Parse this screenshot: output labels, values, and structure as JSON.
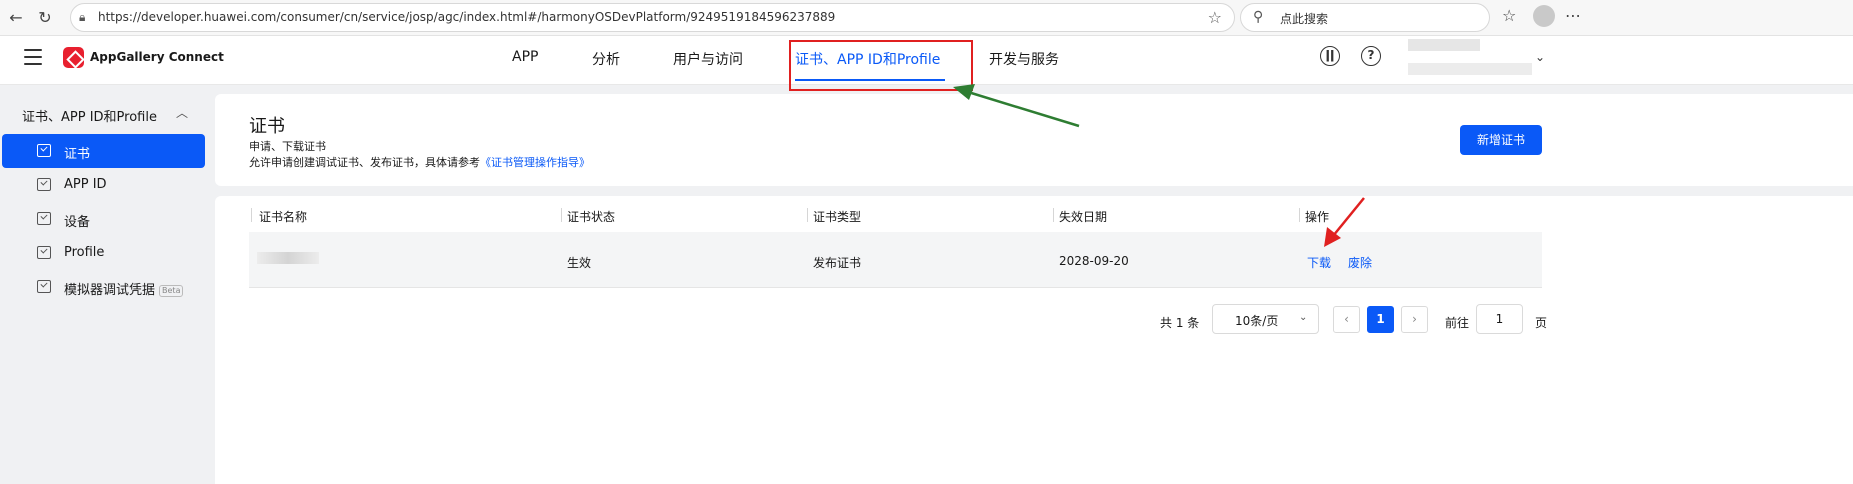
{
  "browser": {
    "url": "https://developer.huawei.com/consumer/cn/service/josp/agc/index.html#/harmonyOSDevPlatform/9249519184596237889",
    "search_placeholder": "点此搜索"
  },
  "header": {
    "brand": "AppGallery Connect",
    "nav": [
      {
        "label": "APP"
      },
      {
        "label": "分析"
      },
      {
        "label": "用户与访问"
      },
      {
        "label": "证书、APP ID和Profile",
        "active": true
      },
      {
        "label": "开发与服务"
      }
    ]
  },
  "sidebar": {
    "group_label": "证书、APP ID和Profile",
    "items": [
      {
        "label": "证书",
        "active": true
      },
      {
        "label": "APP ID"
      },
      {
        "label": "设备"
      },
      {
        "label": "Profile"
      },
      {
        "label": "模拟器调试凭据",
        "badge": "Beta"
      }
    ]
  },
  "page": {
    "title": "证书",
    "subtitle": "申请、下载证书",
    "description": "允许申请创建调试证书、发布证书，具体请参考",
    "guide_link": "《证书管理操作指导》",
    "new_button": "新增证书"
  },
  "table": {
    "columns": [
      "证书名称",
      "证书状态",
      "证书类型",
      "失效日期",
      "操作"
    ],
    "rows": [
      {
        "status": "生效",
        "type": "发布证书",
        "expiry": "2028-09-20",
        "action_download": "下载",
        "action_revoke": "废除"
      }
    ]
  },
  "pagination": {
    "total": "共 1 条",
    "page_size": "10条/页",
    "prev": "‹",
    "current": "1",
    "next": "›",
    "goto_label": "前往",
    "goto_value": "1",
    "page_suffix": "页"
  },
  "colors": {
    "accent": "#0a59f7",
    "annotation_red": "#e02020",
    "annotation_green": "#2e7d32"
  }
}
